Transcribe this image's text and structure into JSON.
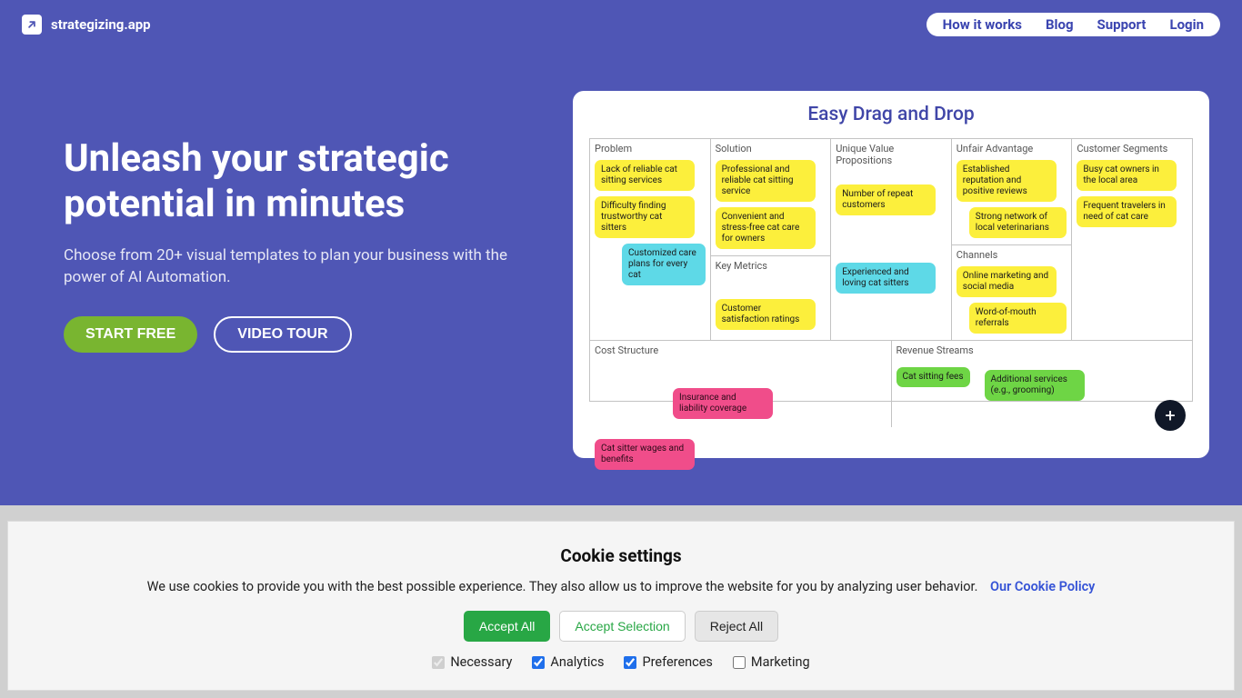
{
  "brand": "strategizing.app",
  "nav": {
    "how": "How it works",
    "blog": "Blog",
    "support": "Support",
    "login": "Login"
  },
  "hero": {
    "title": "Unleash your strategic potential in minutes",
    "subtitle": "Choose from 20+ visual templates to plan your business with the power of AI Automation.",
    "start": "START FREE",
    "tour": "VIDEO TOUR"
  },
  "canvas": {
    "title": "Easy Drag and Drop",
    "labels": {
      "problem": "Problem",
      "solution": "Solution",
      "key_metrics": "Key Metrics",
      "uvp": "Unique Value Propositions",
      "unfair": "Unfair Advantage",
      "channels": "Channels",
      "segments": "Customer Segments",
      "cost": "Cost Structure",
      "revenue": "Revenue Streams"
    },
    "notes": {
      "problem1": "Lack of reliable cat sitting services",
      "problem2": "Difficulty finding trustworthy cat sitters",
      "problem3": "Customized care plans for every cat",
      "solution1": "Professional and reliable cat sitting service",
      "solution2": "Convenient and stress-free cat care for owners",
      "key_metrics1": "Customer satisfaction ratings",
      "uvp1": "Number of repeat customers",
      "uvp2": "Experienced and loving cat sitters",
      "unfair1": "Established reputation and positive reviews",
      "unfair2": "Strong network of local veterinarians",
      "channels1": "Online marketing and social media",
      "channels2": "Word-of-mouth referrals",
      "segments1": "Busy cat owners in the local area",
      "segments2": "Frequent travelers in need of cat care",
      "cost1": "Insurance and liability coverage",
      "cost2": "Cat sitter wages and benefits",
      "revenue1": "Cat sitting fees",
      "revenue2": "Additional services (e.g., grooming)"
    }
  },
  "cookies": {
    "title": "Cookie settings",
    "desc": "We use cookies to provide you with the best possible experience. They also allow us to improve the website for you by analyzing user behavior.",
    "policy": "Our Cookie Policy",
    "accept_all": "Accept All",
    "accept_sel": "Accept Selection",
    "reject": "Reject All",
    "opts": {
      "necessary": "Necessary",
      "analytics": "Analytics",
      "preferences": "Preferences",
      "marketing": "Marketing"
    }
  }
}
